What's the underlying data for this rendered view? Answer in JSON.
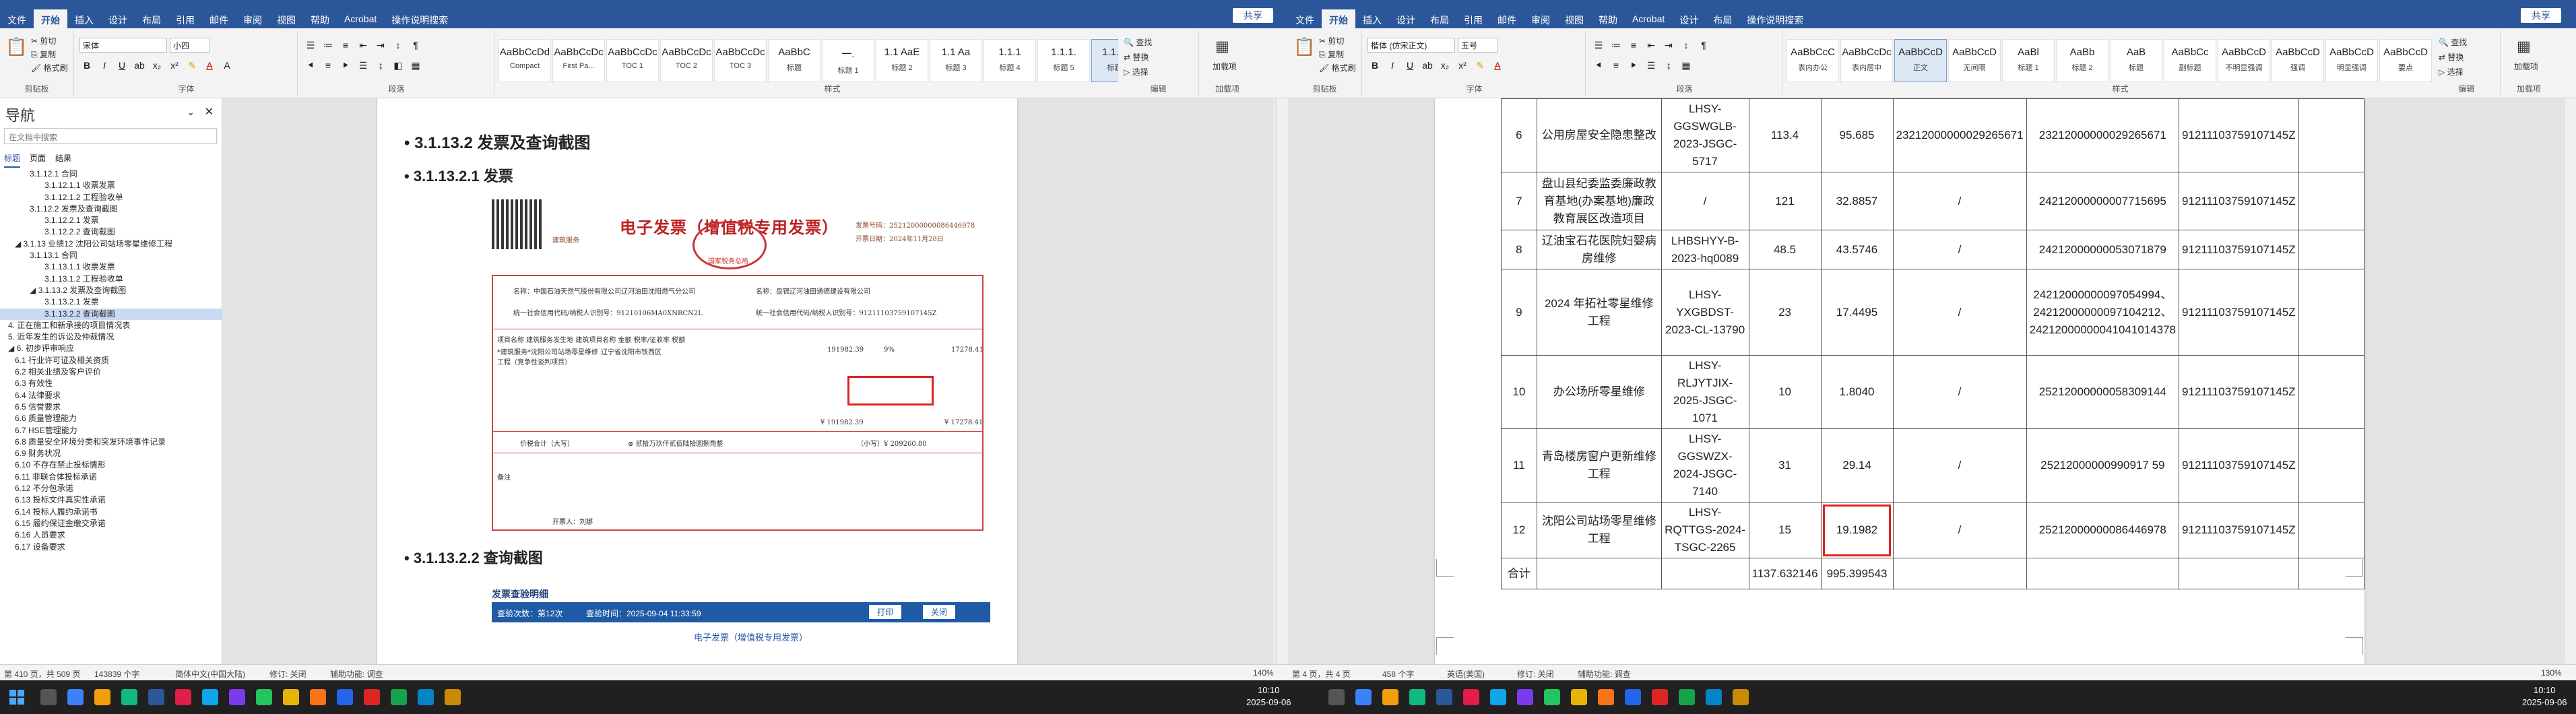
{
  "left": {
    "tabs": [
      "文件",
      "开始",
      "插入",
      "设计",
      "布局",
      "引用",
      "邮件",
      "审阅",
      "视图",
      "帮助",
      "Acrobat",
      "操作说明搜索"
    ],
    "share": "共享",
    "font_name": "宋体",
    "font_size": "小四",
    "styles": [
      {
        "sample": "AaBbCcDd",
        "name": "Compact"
      },
      {
        "sample": "AaBbCcDc",
        "name": "First Pa..."
      },
      {
        "sample": "AaBbCcDc",
        "name": "TOC 1"
      },
      {
        "sample": "AaBbCcDc",
        "name": "TOC 2"
      },
      {
        "sample": "AaBbCcDc",
        "name": "TOC 3"
      },
      {
        "sample": "AaBbC",
        "name": "标题"
      },
      {
        "sample": "一.",
        "name": "标题 1"
      },
      {
        "sample": "1.1 AaE",
        "name": "标题 2"
      },
      {
        "sample": "1.1 Aa",
        "name": "标题 3"
      },
      {
        "sample": "1.1.1",
        "name": "标题 4"
      },
      {
        "sample": "1.1.1.",
        "name": "标题 5"
      },
      {
        "sample": "1.1.1.1",
        "name": "标题 6"
      }
    ],
    "groups": {
      "clipboard": "剪贴板",
      "font": "字体",
      "paragraph": "段落",
      "styles": "样式",
      "editing": "编辑",
      "addin": "加载项"
    },
    "clipboard": {
      "cut": "剪切",
      "copy": "复制",
      "format_painter": "格式刷"
    },
    "editing": {
      "find": "查找",
      "replace": "替换",
      "select": "选择"
    },
    "addin": {
      "label": "加载项"
    },
    "nav": {
      "title": "导航",
      "search_placeholder": "在文档中搜索",
      "tabs": [
        "标题",
        "页面",
        "结果"
      ],
      "items": [
        "3.1.12.1 合同",
        "3.1.12.1.1 收票发票",
        "3.1.12.1.2 工程验收单",
        "3.1.12.2 发票及查询截图",
        "3.1.12.2.1 发票",
        "3.1.12.2.2 查询截图",
        "3.1.13 业绩12 沈阳公司站场零星维修工程",
        "3.1.13.1 合同",
        "3.1.13.1.1 收票发票",
        "3.1.13.1.2 工程验收单",
        "3.1.13.2 发票及查询截图",
        "3.1.13.2.1 发票",
        "3.1.13.2.2 查询截图",
        "4. 正在施工和新承接的项目情况表",
        "5. 近年发生的诉讼及仲裁情况",
        "6. 初步评审响应",
        "6.1 行业许可证及相关资质",
        "6.2 相关业绩及客户评价",
        "6.3 有效性",
        "6.4 法律要求",
        "6.5 信誉要求",
        "6.6 质量管理能力",
        "6.7 HSE管理能力",
        "6.8 质量安全环境分类和突发环境事件记录",
        "6.9 财务状况",
        "6.10 不存在禁止投标情形",
        "6.11 非联合体投标承诺",
        "6.12 不分包承诺",
        "6.13 投标文件真实性承诺",
        "6.14 投标人履约承诺书",
        "6.15 履约保证金缴交承诺",
        "6.16 人员要求",
        "6.17 设备要求"
      ]
    },
    "doc": {
      "heading_l4": "3.1.13.2  发票及查询截图",
      "heading_l5": "3.1.13.2.1    发票",
      "heading_l5b": "3.1.13.2.2    查询截图",
      "invoice": {
        "title": "电子发票（增值税专用发票）",
        "seal_text": "国家税务总局",
        "issuer_type": "建筑服务",
        "number_label": "发票号码：25212000000086446978",
        "date_label": "开票日期：2024年11月28日",
        "buyer": "名称：中国石油天然气股份有限公司辽河油田沈阳燃气分公司",
        "buyer_id": "统一社会信用代码/纳税人识别号：91210106MA0XNRCN2L",
        "seller": "名称：盘锦辽河油田通德建设有限公司",
        "seller_id": "统一社会信用代码/纳税人识别号：91211103759107145Z",
        "item_header": "项目名称  建筑服务发生地  建筑项目名称  金额  税率/征收率  税额",
        "item_name": "*建筑服务*沈阳公司站场零星维修工程（竞争性谈判项目）",
        "item_place": "辽宁省沈阳市铁西区",
        "item_amount": "191982.39",
        "item_rate": "9%",
        "item_tax": "17278.41",
        "sum_label": "价税合计（大写）",
        "sum_upper": "贰拾万玖仟贰佰陆拾圆捌角整",
        "sum_lower": "（小写）¥ 209260.80",
        "total_amount": "¥ 191982.39",
        "total_tax": "¥ 17278.41",
        "remark": "备注",
        "drawer": "开票人：刘娜"
      },
      "portal": {
        "title": "发票查验明细",
        "count_label": "查验次数：第12次",
        "time_label": "查验时间：2025-09-04 11:33:59",
        "print": "打印",
        "close": "关闭",
        "subtitle": "电子发票（增值税专用发票）"
      }
    },
    "status": {
      "page": "第 410 页，共 509 页",
      "words": "143839 个字",
      "lang": "简体中文(中国大陆)",
      "track": "修订: 关闭",
      "access": "辅助功能: 调查",
      "zoom": "140%"
    }
  },
  "right": {
    "tabs": [
      "文件",
      "开始",
      "插入",
      "设计",
      "布局",
      "引用",
      "邮件",
      "审阅",
      "视图",
      "帮助",
      "Acrobat",
      "设计",
      "布局",
      "操作说明搜索"
    ],
    "share": "共享",
    "font_name": "楷体 (仿宋正文)",
    "font_size": "五号",
    "styles": [
      {
        "sample": "AaBbCcC",
        "name": "表内办公"
      },
      {
        "sample": "AaBbCcDc",
        "name": "表内居中"
      },
      {
        "sample": "AaBbCcD",
        "name": "正文"
      },
      {
        "sample": "AaBbCcD",
        "name": "无间隔"
      },
      {
        "sample": "AaBl",
        "name": "标题 1"
      },
      {
        "sample": "AaBb",
        "name": "标题 2"
      },
      {
        "sample": "AaB",
        "name": "标题"
      },
      {
        "sample": "AaBbCc",
        "name": "副标题"
      },
      {
        "sample": "AaBbCcD",
        "name": "不明显强调"
      },
      {
        "sample": "AaBbCcD",
        "name": "强调"
      },
      {
        "sample": "AaBbCcD",
        "name": "明显强调"
      },
      {
        "sample": "AaBbCcD",
        "name": "要点"
      }
    ],
    "table": {
      "rows": [
        {
          "no": "6",
          "name": "公用房屋安全隐患整改",
          "code": "LHSY-GGSWGLB-2023-JSGC-5717",
          "amount": "113.4",
          "ratio": "95.685",
          "invoice": "23212000000029265671",
          "invoice2": "23212000000029265671",
          "taxid": "91211103759107145Z"
        },
        {
          "no": "7",
          "name": "盘山县纪委监委廉政教育基地(办案基地)廉政教育展区改造项目",
          "code": "/",
          "amount": "121",
          "ratio": "32.8857",
          "invoice": "/",
          "invoice2": "24212000000007715695",
          "taxid": "91211103759107145Z"
        },
        {
          "no": "8",
          "name": "辽油宝石花医院妇婴病房维修",
          "code": "LHBSHYY-B-2023-hq0089",
          "amount": "48.5",
          "ratio": "43.5746",
          "invoice": "/",
          "invoice2": "24212000000053071879",
          "taxid": "91211103759107145Z"
        },
        {
          "no": "9",
          "name": "2024 年拓社零星维修工程",
          "code": "LHSY-YXGBDST-2023-CL-13790",
          "amount": "23",
          "ratio": "17.4495",
          "invoice": "/",
          "invoice2": "24212000000097054994、24212000000097104212、24212000000041041014378",
          "taxid": "91211103759107145Z"
        },
        {
          "no": "10",
          "name": "办公场所零星维修",
          "code": "LHSY-RLJYTJIX-2025-JSGC-1071",
          "amount": "10",
          "ratio": "1.8040",
          "invoice": "/",
          "invoice2": "25212000000058309144",
          "taxid": "91211103759107145Z"
        },
        {
          "no": "11",
          "name": "青岛楼房窗户更新维修工程",
          "code": "LHSY-GGSWZX-2024-JSGC-7140",
          "amount": "31",
          "ratio": "29.14",
          "invoice": "/",
          "invoice2": "25212000000990917 59",
          "taxid": "91211103759107145Z"
        },
        {
          "no": "12",
          "name": "沈阳公司站场零星维修工程",
          "code": "LHSY-RQTTGS-2024-TSGC-2265",
          "amount": "15",
          "ratio": "19.1982",
          "invoice": "/",
          "invoice2": "25212000000086446978",
          "taxid": "91211103759107145Z"
        },
        {
          "no": "合计",
          "name": "",
          "code": "",
          "amount": "1137.632146",
          "ratio": "995.399543",
          "invoice": "",
          "invoice2": "",
          "taxid": ""
        }
      ]
    },
    "status": {
      "page": "第 4 页，共 4 页",
      "words": "458 个字",
      "lang": "英语(美国)",
      "track": "修订: 关闭",
      "access": "辅助功能: 调查",
      "zoom": "130%"
    }
  },
  "taskbar": {
    "time_left": "10:10",
    "date_left": "2025-09-06",
    "time_right": "10:10",
    "date_right": "2025-09-06"
  }
}
